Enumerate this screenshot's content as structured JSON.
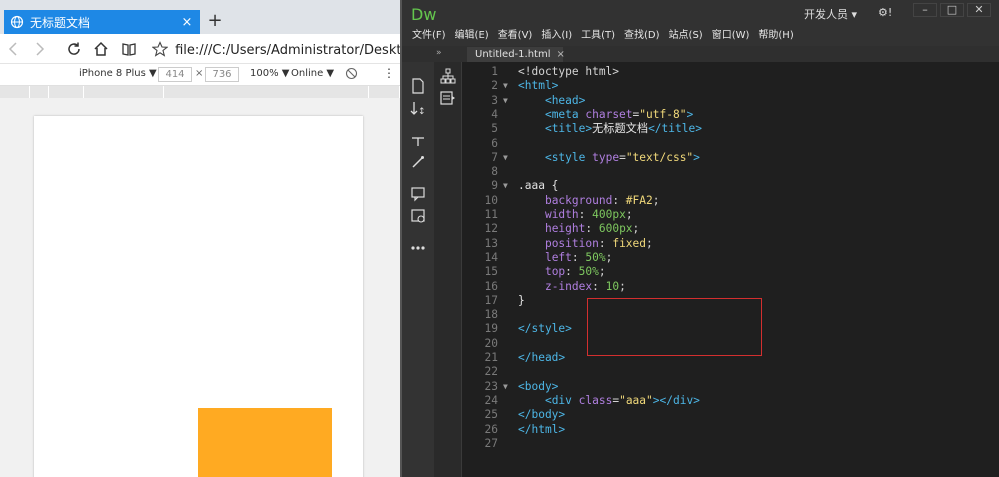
{
  "browser": {
    "tab_title": "无标题文档",
    "tab_close": "×",
    "new_tab": "+",
    "url": "file:///C:/Users/Administrator/Desktop/新建",
    "device": "iPhone 8 Plus ▼",
    "width_value": "414",
    "times": "×",
    "height_value": "736",
    "zoom": "100% ▼",
    "network": "Online ▼",
    "more": "⋮",
    "rendered_box_color": "#FFAA22"
  },
  "dw": {
    "logo": "Dw",
    "workspace": "开发人员 ▾",
    "gear": "⚙!",
    "min": "–",
    "max": "□",
    "close": "✕",
    "menu": [
      "文件(F)",
      "编辑(E)",
      "查看(V)",
      "插入(I)",
      "工具(T)",
      "查找(D)",
      "站点(S)",
      "窗口(W)",
      "帮助(H)"
    ],
    "collapse": "»",
    "file_tab": "Untitled-1.html",
    "file_tab_close": "×",
    "code_lines": [
      {
        "n": "1",
        "fold": "",
        "segs": [
          [
            "t-pun",
            "<!doctype html>"
          ]
        ]
      },
      {
        "n": "2",
        "fold": "▼",
        "segs": [
          [
            "t-tag",
            "<html>"
          ]
        ]
      },
      {
        "n": "3",
        "fold": "▼",
        "segs": [
          [
            "t-pun",
            "    "
          ],
          [
            "t-tag",
            "<head>"
          ]
        ]
      },
      {
        "n": "4",
        "fold": "",
        "segs": [
          [
            "t-pun",
            "    "
          ],
          [
            "t-tag",
            "<meta "
          ],
          [
            "t-attr",
            "charset"
          ],
          [
            "t-pun",
            "="
          ],
          [
            "t-str",
            "\"utf-8\""
          ],
          [
            "t-tag",
            ">"
          ]
        ]
      },
      {
        "n": "5",
        "fold": "",
        "segs": [
          [
            "t-pun",
            "    "
          ],
          [
            "t-tag",
            "<title>"
          ],
          [
            "t-text",
            "无标题文档"
          ],
          [
            "t-tag",
            "</title>"
          ]
        ]
      },
      {
        "n": "6",
        "fold": "",
        "segs": []
      },
      {
        "n": "7",
        "fold": "▼",
        "segs": [
          [
            "t-pun",
            "    "
          ],
          [
            "t-tag",
            "<style "
          ],
          [
            "t-attr",
            "type"
          ],
          [
            "t-pun",
            "="
          ],
          [
            "t-str",
            "\"text/css\""
          ],
          [
            "t-tag",
            ">"
          ]
        ]
      },
      {
        "n": "8",
        "fold": "",
        "segs": []
      },
      {
        "n": "9",
        "fold": "▼",
        "segs": [
          [
            "t-sel",
            ".aaa {"
          ]
        ]
      },
      {
        "n": "10",
        "fold": "",
        "segs": [
          [
            "t-pun",
            "    "
          ],
          [
            "t-prop",
            "background"
          ],
          [
            "t-pun",
            ": "
          ],
          [
            "t-val",
            "#FA2"
          ],
          [
            "t-pun",
            ";"
          ]
        ]
      },
      {
        "n": "11",
        "fold": "",
        "segs": [
          [
            "t-pun",
            "    "
          ],
          [
            "t-prop",
            "width"
          ],
          [
            "t-pun",
            ": "
          ],
          [
            "t-num",
            "400px"
          ],
          [
            "t-pun",
            ";"
          ]
        ]
      },
      {
        "n": "12",
        "fold": "",
        "segs": [
          [
            "t-pun",
            "    "
          ],
          [
            "t-prop",
            "height"
          ],
          [
            "t-pun",
            ": "
          ],
          [
            "t-num",
            "600px"
          ],
          [
            "t-pun",
            ";"
          ]
        ]
      },
      {
        "n": "13",
        "fold": "",
        "segs": [
          [
            "t-pun",
            "    "
          ],
          [
            "t-prop",
            "position"
          ],
          [
            "t-pun",
            ": "
          ],
          [
            "t-val",
            "fixed"
          ],
          [
            "t-pun",
            ";"
          ]
        ]
      },
      {
        "n": "14",
        "fold": "",
        "segs": [
          [
            "t-pun",
            "    "
          ],
          [
            "t-prop",
            "left"
          ],
          [
            "t-pun",
            ": "
          ],
          [
            "t-num",
            "50%"
          ],
          [
            "t-pun",
            ";"
          ]
        ]
      },
      {
        "n": "15",
        "fold": "",
        "segs": [
          [
            "t-pun",
            "    "
          ],
          [
            "t-prop",
            "top"
          ],
          [
            "t-pun",
            ": "
          ],
          [
            "t-num",
            "50%"
          ],
          [
            "t-pun",
            ";"
          ]
        ]
      },
      {
        "n": "16",
        "fold": "",
        "segs": [
          [
            "t-pun",
            "    "
          ],
          [
            "t-prop",
            "z-index"
          ],
          [
            "t-pun",
            ": "
          ],
          [
            "t-num",
            "10"
          ],
          [
            "t-pun",
            ";"
          ]
        ]
      },
      {
        "n": "17",
        "fold": "",
        "segs": [
          [
            "t-sel",
            "}"
          ]
        ]
      },
      {
        "n": "18",
        "fold": "",
        "segs": []
      },
      {
        "n": "19",
        "fold": "",
        "segs": [
          [
            "t-tag",
            "</style>"
          ]
        ]
      },
      {
        "n": "20",
        "fold": "",
        "segs": []
      },
      {
        "n": "21",
        "fold": "",
        "segs": [
          [
            "t-tag",
            "</head>"
          ]
        ]
      },
      {
        "n": "22",
        "fold": "",
        "segs": []
      },
      {
        "n": "23",
        "fold": "▼",
        "segs": [
          [
            "t-tag",
            "<body>"
          ]
        ]
      },
      {
        "n": "24",
        "fold": "",
        "segs": [
          [
            "t-pun",
            "    "
          ],
          [
            "t-tag",
            "<div "
          ],
          [
            "t-attr",
            "class"
          ],
          [
            "t-pun",
            "="
          ],
          [
            "t-str",
            "\"aaa\""
          ],
          [
            "t-tag",
            "></div>"
          ]
        ]
      },
      {
        "n": "25",
        "fold": "",
        "segs": [
          [
            "t-tag",
            "</body>"
          ]
        ]
      },
      {
        "n": "26",
        "fold": "",
        "segs": [
          [
            "t-tag",
            "</html>"
          ]
        ]
      },
      {
        "n": "27",
        "fold": "",
        "segs": []
      }
    ]
  }
}
